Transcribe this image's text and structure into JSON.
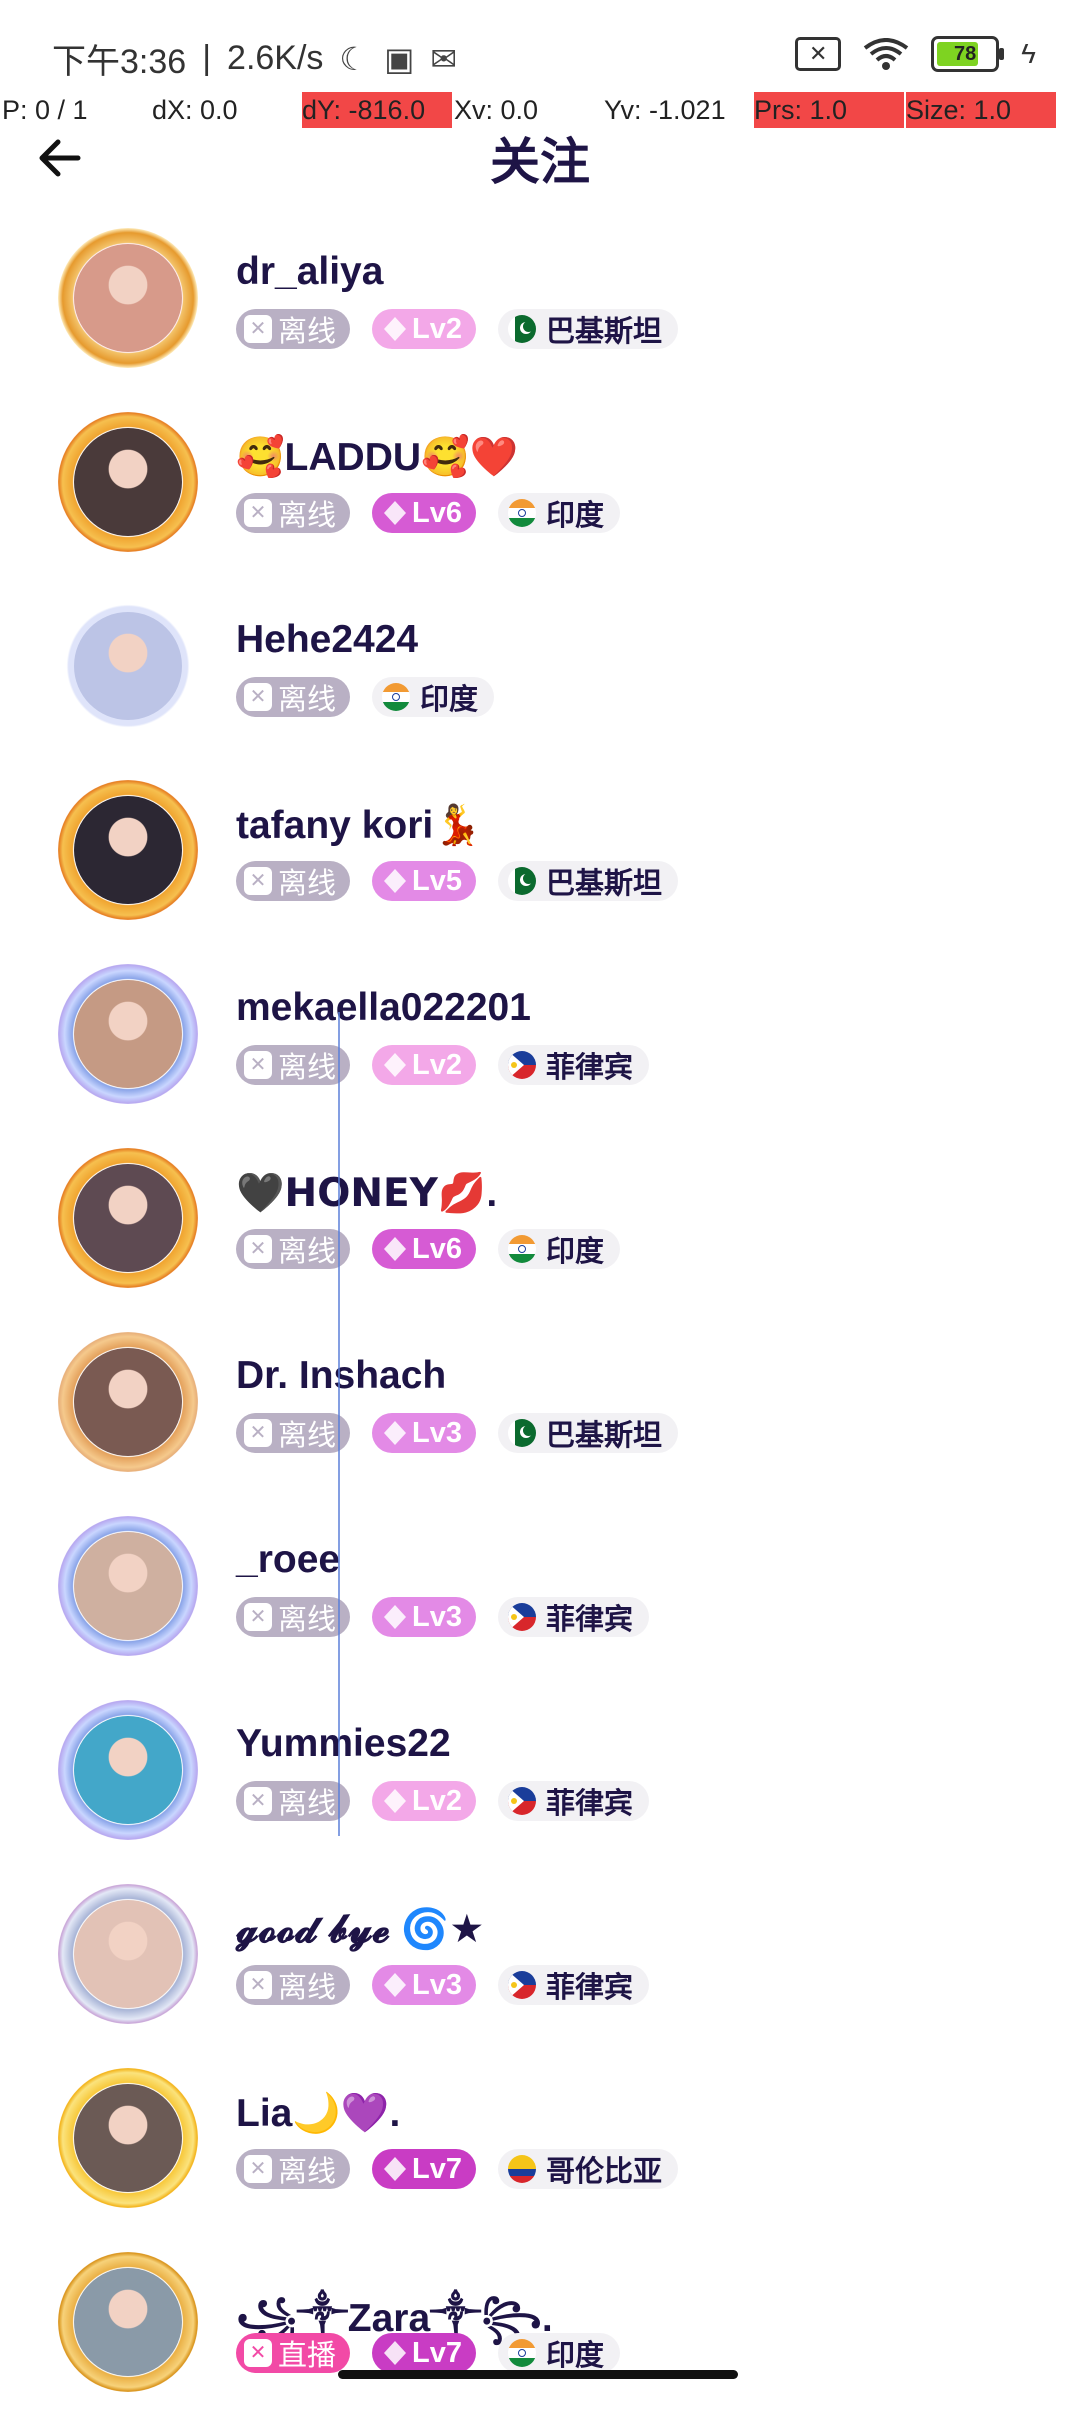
{
  "status_bar": {
    "time": "下午3:36",
    "separator": "|",
    "speed": "2.6K/s",
    "battery": "78",
    "battery_level": 0.78
  },
  "debug_bar": {
    "p": "P: 0 / 1",
    "dx": "dX: 0.0",
    "dy": "dY: -816.0",
    "xv": "Xv: 0.0",
    "yv": "Yv: -1.021",
    "prs": "Prs: 1.0",
    "size": "Size: 1.0"
  },
  "header": {
    "title": "关注"
  },
  "users": [
    {
      "name": "dr_aliya",
      "status": "离线",
      "live": false,
      "level": "Lv2",
      "country": "巴基斯坦",
      "flag": "pk",
      "frame": "gold-pink",
      "level_color": "#f3a8e8",
      "photo_color": "#d79a8a"
    },
    {
      "name": "🥰LADDU🥰❤️",
      "status": "离线",
      "live": false,
      "level": "Lv6",
      "country": "印度",
      "flag": "in",
      "frame": "gold-devil",
      "level_color": "#d65bd4",
      "photo_color": "#4a3a3a"
    },
    {
      "name": "Hehe2424",
      "status": "离线",
      "live": false,
      "level": "",
      "country": "印度",
      "flag": "in",
      "frame": "robot",
      "level_color": "",
      "photo_color": "#bcc4e6"
    },
    {
      "name": "tafany kori💃",
      "status": "离线",
      "live": false,
      "level": "Lv5",
      "country": "巴基斯坦",
      "flag": "pk",
      "frame": "gold-devil",
      "level_color": "#e38ae6",
      "photo_color": "#2c2733"
    },
    {
      "name": "mekaella022201",
      "status": "离线",
      "live": false,
      "level": "Lv2",
      "country": "菲律宾",
      "flag": "ph",
      "frame": "silver-wings",
      "level_color": "#f3a8e8",
      "photo_color": "#c59a84"
    },
    {
      "name": "🖤𝗛𝗢𝗡𝗘𝗬💋.",
      "status": "离线",
      "live": false,
      "level": "Lv6",
      "country": "印度",
      "flag": "in",
      "frame": "gold-devil",
      "level_color": "#d65bd4",
      "photo_color": "#5e4a52"
    },
    {
      "name": "Dr. Inshach",
      "status": "离线",
      "live": false,
      "level": "Lv3",
      "country": "巴基斯坦",
      "flag": "pk",
      "frame": "gold-wings",
      "level_color": "#e38ae6",
      "photo_color": "#7a5a52"
    },
    {
      "name": "_roee",
      "status": "离线",
      "live": false,
      "level": "Lv3",
      "country": "菲律宾",
      "flag": "ph",
      "frame": "silver-wings",
      "level_color": "#e38ae6",
      "photo_color": "#cfb0a0"
    },
    {
      "name": "Yummies22",
      "status": "离线",
      "live": false,
      "level": "Lv2",
      "country": "菲律宾",
      "flag": "ph",
      "frame": "silver-wings",
      "level_color": "#f3a8e8",
      "photo_color": "#43a7c9"
    },
    {
      "name": "𝓰𝓸𝓸𝓭 𝓫𝔂𝓮 🌀★",
      "status": "离线",
      "live": false,
      "level": "Lv3",
      "country": "菲律宾",
      "flag": "ph",
      "frame": "silver-plain",
      "level_color": "#e38ae6",
      "photo_color": "#e2c2b6"
    },
    {
      "name": "Lia🌙💜.",
      "status": "离线",
      "live": false,
      "level": "Lv7",
      "country": "哥伦比亚",
      "flag": "co",
      "frame": "gold-stars",
      "level_color": "#c93cc4",
      "photo_color": "#6b5a55"
    },
    {
      "name": "꧁༒Zara༒꧂.",
      "status": "直播",
      "live": true,
      "level": "Lv7",
      "country": "印度",
      "flag": "in",
      "frame": "gold-crown",
      "level_color": "#c93cc4",
      "photo_color": "#8a9aa8"
    }
  ]
}
